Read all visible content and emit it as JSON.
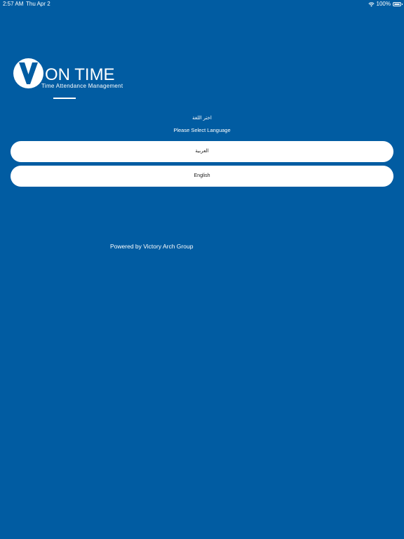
{
  "status_bar": {
    "time": "2:57 AM",
    "date": "Thu Apr 2",
    "battery_percent": "100%",
    "battery_level": 1.0,
    "wifi_icon": "wifi-icon",
    "battery_icon": "battery-icon"
  },
  "logo": {
    "title": "ON TIME",
    "subtitle": "Time Attendance Management",
    "mark_icon": "v-logo-mark"
  },
  "language_prompt": {
    "arabic": "اختر اللغة",
    "english": "Please Select Language"
  },
  "buttons": {
    "arabic_label": "العربية",
    "english_label": "English"
  },
  "footer": {
    "powered_by": "Powered by Victory Arch Group"
  },
  "colors": {
    "background": "#015ca2",
    "button_background": "#ffffff",
    "button_text": "#1a1a1a"
  }
}
